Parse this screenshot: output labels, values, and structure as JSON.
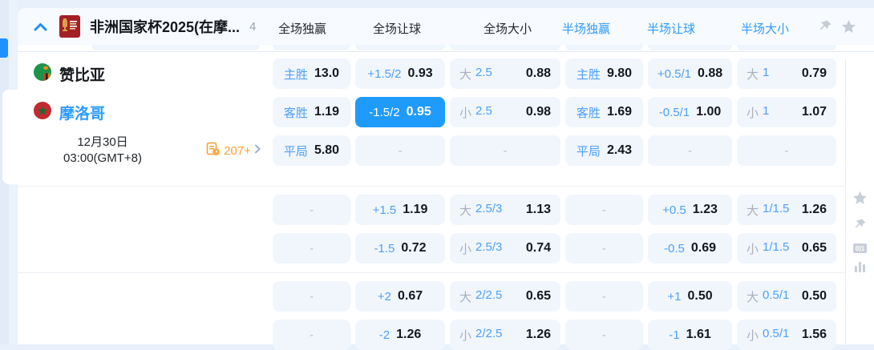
{
  "header": {
    "title": "非洲国家杯2025(在摩...",
    "match_count": "4",
    "tabs": [
      {
        "label": "全场独赢",
        "style": "dark"
      },
      {
        "label": "全场让球",
        "style": "dark"
      },
      {
        "label": "全场大小",
        "style": "dark"
      },
      {
        "label": "半场独赢",
        "style": "blue"
      },
      {
        "label": "半场让球",
        "style": "blue"
      },
      {
        "label": "半场大小",
        "style": "blue"
      }
    ]
  },
  "match": {
    "home_team": "赞比亚",
    "away_team": "摩洛哥",
    "date_line1": "12月30日",
    "date_line2": "03:00(GMT+8)",
    "more_markets": "207+"
  },
  "odds": {
    "dash": "-",
    "s1r1": {
      "c1l": "主胜",
      "c1v": "13.0",
      "c2l": "+1.5/2",
      "c2v": "0.93",
      "c3o": "大",
      "c3l": "2.5",
      "c3v": "0.88",
      "c4l": "主胜",
      "c4v": "9.80",
      "c5l": "+0.5/1",
      "c5v": "0.88",
      "c6o": "大",
      "c6l": "1",
      "c6v": "0.79"
    },
    "s1r2": {
      "c1l": "客胜",
      "c1v": "1.19",
      "c2l": "-1.5/2",
      "c2v": "0.95",
      "c3o": "小",
      "c3l": "2.5",
      "c3v": "0.98",
      "c4l": "客胜",
      "c4v": "1.69",
      "c5l": "-0.5/1",
      "c5v": "1.00",
      "c6o": "小",
      "c6l": "1",
      "c6v": "1.07"
    },
    "s1r3": {
      "c1l": "平局",
      "c1v": "5.80",
      "c4l": "平局",
      "c4v": "2.43"
    },
    "s2r1": {
      "c2l": "+1.5",
      "c2v": "1.19",
      "c3o": "大",
      "c3l": "2.5/3",
      "c3v": "1.13",
      "c5l": "+0.5",
      "c5v": "1.23",
      "c6o": "大",
      "c6l": "1/1.5",
      "c6v": "1.26"
    },
    "s2r2": {
      "c2l": "-1.5",
      "c2v": "0.72",
      "c3o": "小",
      "c3l": "2.5/3",
      "c3v": "0.74",
      "c5l": "-0.5",
      "c5v": "0.69",
      "c6o": "小",
      "c6l": "1/1.5",
      "c6v": "0.65"
    },
    "s3r1": {
      "c2l": "+2",
      "c2v": "0.67",
      "c3o": "大",
      "c3l": "2/2.5",
      "c3v": "0.65",
      "c5l": "+1",
      "c5v": "0.50",
      "c6o": "大",
      "c6l": "0.5/1",
      "c6v": "0.50"
    },
    "s3r2": {
      "c2l": "-2",
      "c2v": "1.26",
      "c3o": "小",
      "c3l": "2/2.5",
      "c3v": "1.26",
      "c5l": "-1",
      "c5v": "1.61",
      "c6o": "小",
      "c6l": "0.5/1",
      "c6v": "1.56"
    }
  },
  "rail": {
    "corner_badge": "0|1"
  },
  "colors": {
    "selected_cell": "#1f9bfd",
    "cell_bg": "#f1f6fd",
    "label_blue": "#4da0f8",
    "tab_blue": "#2e9bfd",
    "orange": "#ff9d2e",
    "zambia_green": "#1c9448",
    "morocco_red": "#c22a30"
  }
}
